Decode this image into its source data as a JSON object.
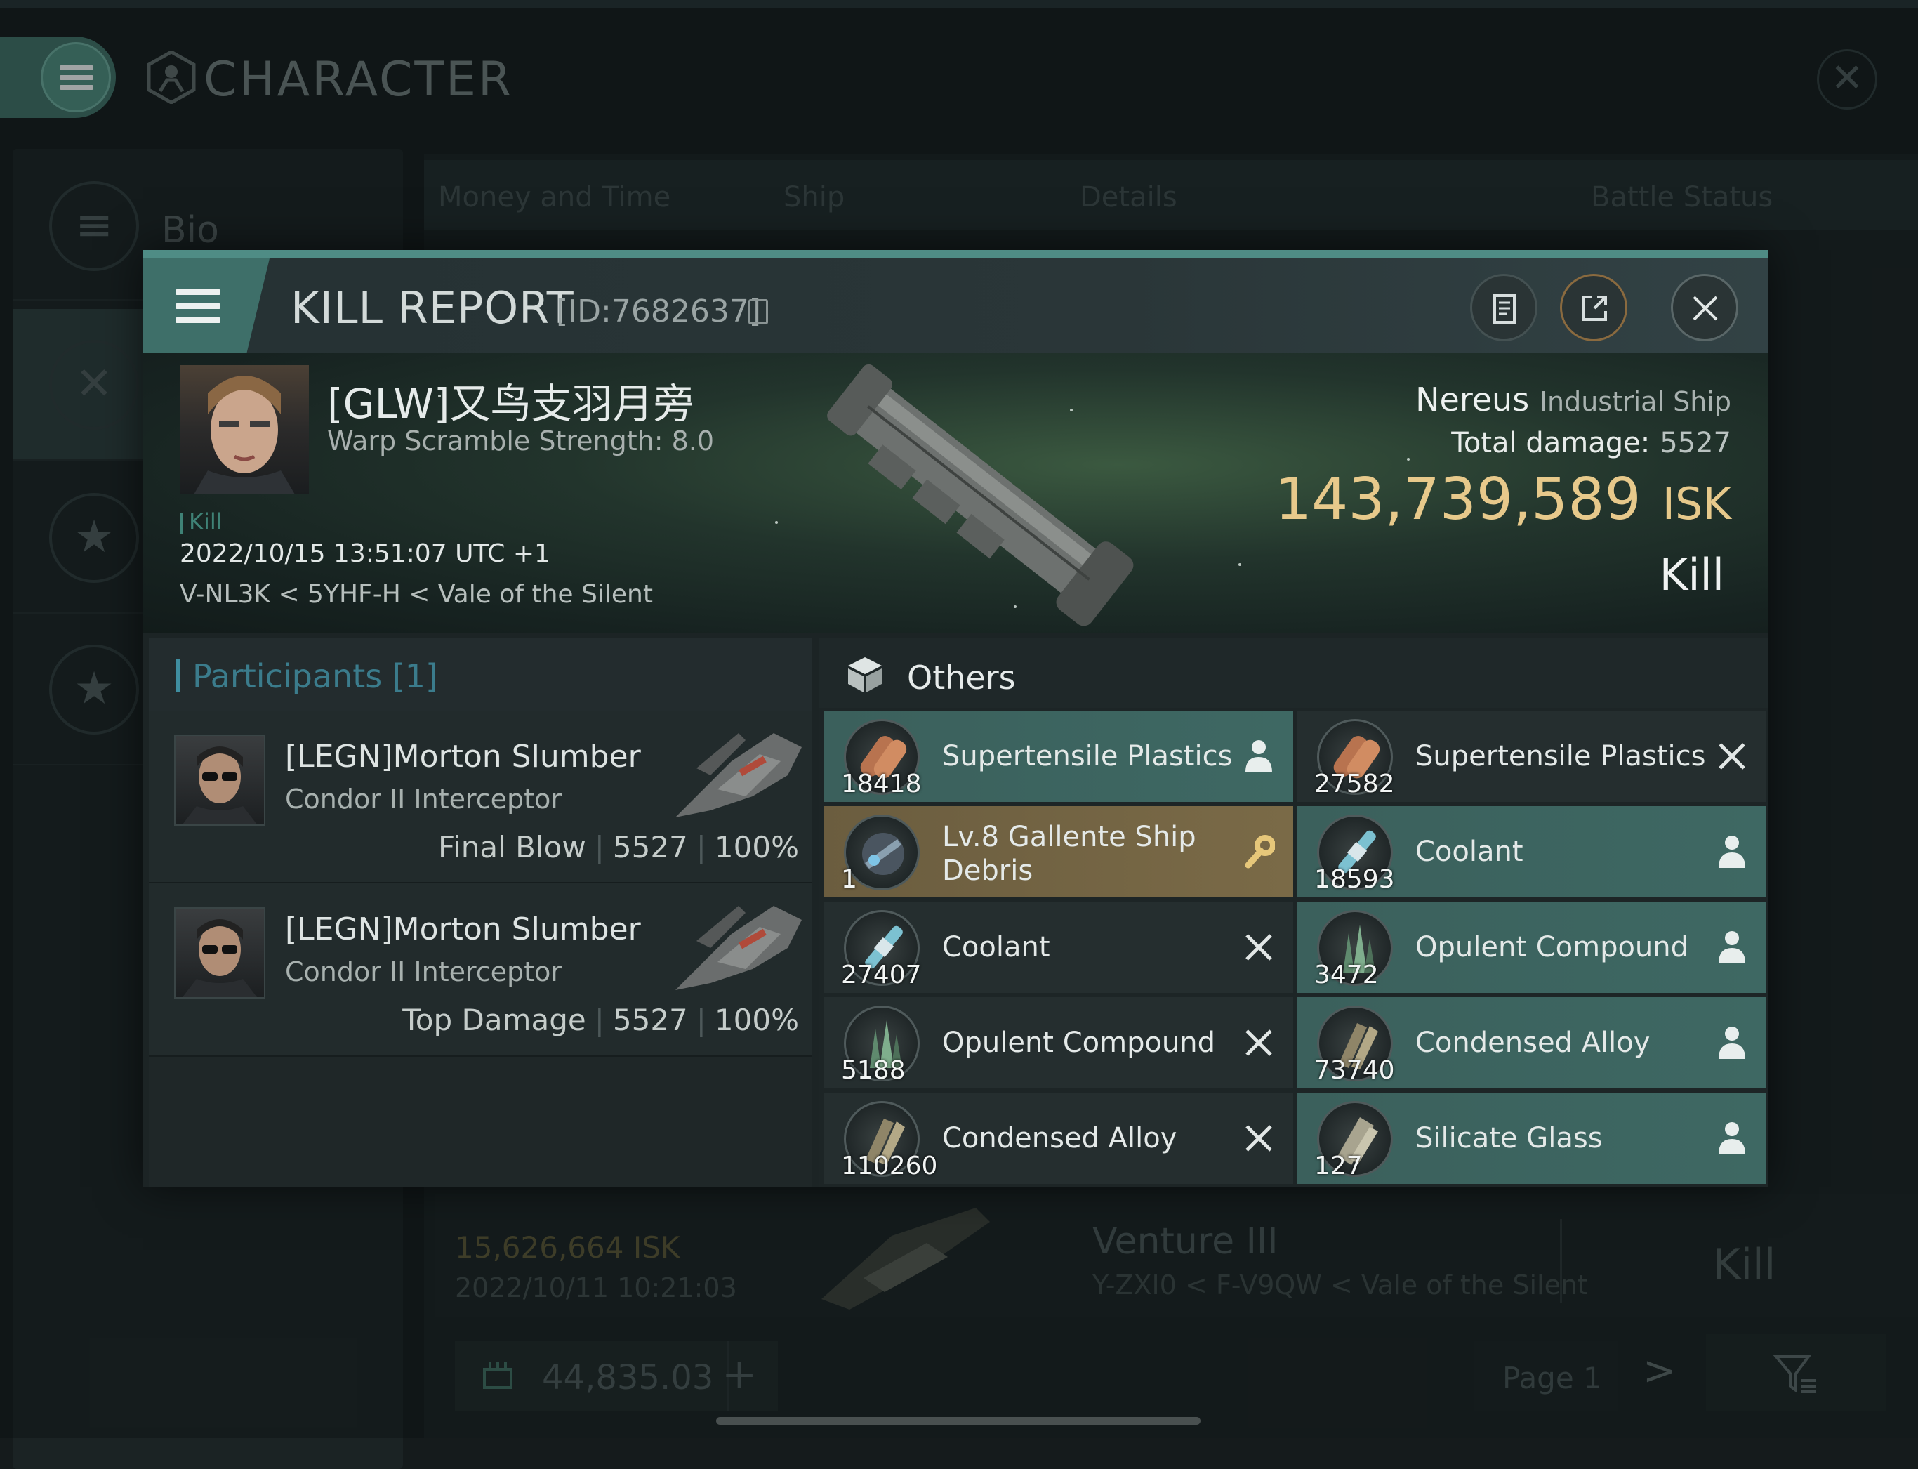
{
  "app": {
    "title": "CHARACTER",
    "side_items": [
      "Bio"
    ]
  },
  "background": {
    "tabs": [
      "Money and Time",
      "Ship",
      "Details",
      "Battle Status"
    ],
    "row": {
      "isk": "15,626,664 ISK",
      "date": "2022/10/11  10:21:03",
      "ship": "Venture III",
      "location": "Y-ZXI0 < F-V9QW < Vale of the Silent",
      "result": "Kill"
    },
    "wallet": "44,835.03",
    "page": "Page 1"
  },
  "kill_report": {
    "title": "KILL REPORT",
    "id": "[ID:7682637]",
    "victim": {
      "name": "[GLW]又鸟支羽月旁",
      "warp_scramble": "Warp Scramble Strength: 8.0",
      "tag": "Kill",
      "time": "2022/10/15 13:51:07 UTC +1",
      "location": "V-NL3K < 5YHF-H < Vale of the Silent"
    },
    "ship": {
      "name": "Nereus",
      "class": "Industrial Ship",
      "damage_label": "Total damage:",
      "damage_value": "5527",
      "isk_value": "143,739,589",
      "isk_unit": "ISK",
      "result": "Kill"
    },
    "participants": {
      "title": "Participants [1]",
      "rows": [
        {
          "name": "[LEGN]Morton Slumber",
          "ship": "Condor II Interceptor",
          "label": "Final Blow",
          "damage": "5527",
          "percent": "100%"
        },
        {
          "name": "[LEGN]Morton Slumber",
          "ship": "Condor II Interceptor",
          "label": "Top Damage",
          "damage": "5527",
          "percent": "100%"
        }
      ]
    },
    "others": {
      "title": "Others",
      "items": [
        {
          "qty": "18418",
          "name": "Supertensile Plastics",
          "style": "teal",
          "status": "person-icon",
          "material": "plastics"
        },
        {
          "qty": "27582",
          "name": "Supertensile Plastics",
          "style": "dark",
          "status": "x-icon",
          "material": "plastics"
        },
        {
          "qty": "1",
          "name": "Lv.8 Gallente Ship Debris",
          "style": "gold",
          "status": "wrench-icon",
          "material": "debris"
        },
        {
          "qty": "18593",
          "name": "Coolant",
          "style": "teal",
          "status": "person-icon",
          "material": "coolant"
        },
        {
          "qty": "27407",
          "name": "Coolant",
          "style": "dark",
          "status": "x-icon",
          "material": "coolant"
        },
        {
          "qty": "3472",
          "name": "Opulent Compound",
          "style": "teal",
          "status": "person-icon",
          "material": "compound"
        },
        {
          "qty": "5188",
          "name": "Opulent Compound",
          "style": "dark",
          "status": "x-icon",
          "material": "compound"
        },
        {
          "qty": "73740",
          "name": "Condensed Alloy",
          "style": "teal",
          "status": "person-icon",
          "material": "alloy"
        },
        {
          "qty": "110260",
          "name": "Condensed Alloy",
          "style": "dark",
          "status": "x-icon",
          "material": "alloy"
        },
        {
          "qty": "127",
          "name": "Silicate Glass",
          "style": "teal",
          "status": "person-icon",
          "material": "glass"
        }
      ]
    }
  },
  "colors": {
    "accent_teal": "#3e6863",
    "isk_gold": "#e7c98b",
    "debris_gold": "#7a6a47"
  }
}
